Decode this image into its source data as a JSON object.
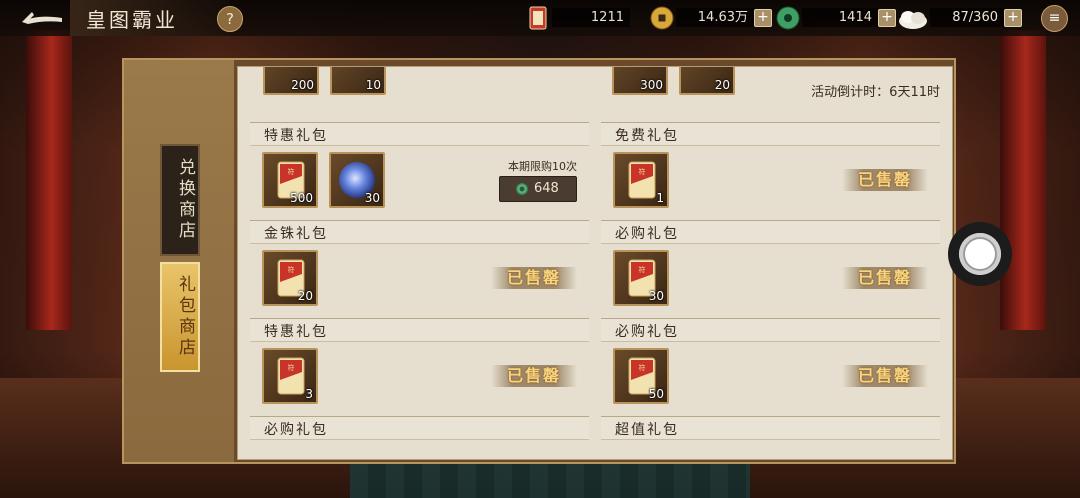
{
  "topbar": {
    "title": "皇图霸业",
    "help": "?",
    "resources": [
      {
        "icon": "red-scroll-icon",
        "value": "1211"
      },
      {
        "icon": "gold-coin-icon",
        "value": "14.63万"
      },
      {
        "icon": "jade-icon",
        "value": "1414"
      },
      {
        "icon": "steamed-bun-icon",
        "value": "87/360"
      }
    ]
  },
  "sidebar": {
    "tabs": [
      {
        "label": "兑换商店",
        "active": false
      },
      {
        "label": "礼包商店",
        "active": true
      }
    ]
  },
  "panel": {
    "countdown": "活动倒计时：6天11时",
    "partial_top": [
      {
        "qty1": "200",
        "qty2": "10"
      },
      {
        "qty1": "300",
        "qty2": "20"
      }
    ],
    "packs": [
      {
        "name": "特惠礼包",
        "items": [
          {
            "icon": "red-scroll-icon",
            "qty": "500"
          },
          {
            "icon": "blue-orb-icon",
            "qty": "30"
          }
        ],
        "limit": "本期限购10次",
        "price": "648"
      },
      {
        "name": "免费礼包",
        "items": [
          {
            "icon": "red-scroll-icon",
            "qty": "1"
          }
        ],
        "status": "已售罄"
      },
      {
        "name": "金铢礼包",
        "items": [
          {
            "icon": "red-scroll-icon",
            "qty": "20"
          }
        ],
        "status": "已售罄"
      },
      {
        "name": "必购礼包",
        "items": [
          {
            "icon": "red-scroll-icon",
            "qty": "30"
          }
        ],
        "status": "已售罄"
      },
      {
        "name": "特惠礼包",
        "items": [
          {
            "icon": "red-scroll-icon",
            "qty": "3"
          }
        ],
        "status": "已售罄"
      },
      {
        "name": "必购礼包",
        "items": [
          {
            "icon": "red-scroll-icon",
            "qty": "50"
          }
        ],
        "status": "已售罄"
      },
      {
        "name": "必购礼包"
      },
      {
        "name": "超值礼包"
      }
    ]
  },
  "colors": {
    "accent_gold": "#e9c46a",
    "sold_text": "#f6d580",
    "panel_bg": "#e6dfcf"
  }
}
